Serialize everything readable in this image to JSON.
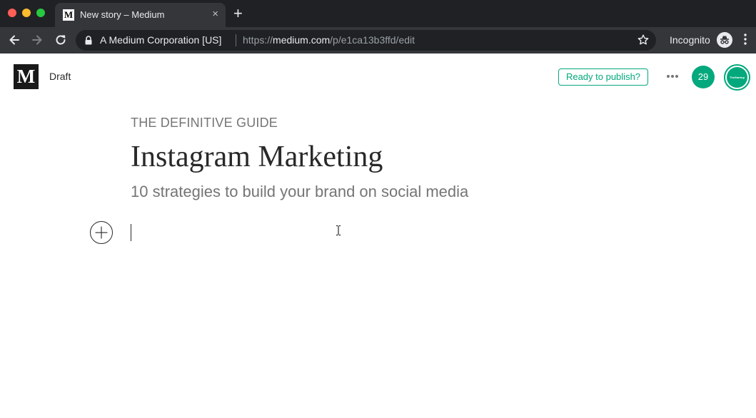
{
  "browser": {
    "tab": {
      "title": "New story – Medium",
      "favicon_letter": "M",
      "close_icon": "×"
    },
    "new_tab_icon": "+",
    "address": {
      "site_identity": "A Medium Corporation [US]",
      "url_scheme": "https://",
      "url_host": "medium.com",
      "url_path": "/p/e1ca13b3ffd/edit"
    },
    "incognito_label": "Incognito"
  },
  "header": {
    "logo_letter": "M",
    "status": "Draft",
    "publish_label": "Ready to publish?",
    "notification_count": "29",
    "avatar_text": "TheStartup"
  },
  "story": {
    "kicker": "THE DEFINITIVE GUIDE",
    "title": "Instagram Marketing",
    "subtitle": "10 strategies to build your brand on social media"
  },
  "colors": {
    "accent": "#03a87c",
    "chrome_dark": "#202124",
    "chrome_toolbar": "#35363a",
    "text_primary": "#292929",
    "text_muted": "#757575"
  },
  "icons": {
    "back": "arrow-left-icon",
    "forward": "arrow-right-icon",
    "reload": "reload-icon",
    "lock": "lock-icon",
    "bookmark": "star-icon",
    "incognito": "incognito-icon",
    "menu": "kebab-menu-icon",
    "more": "more-dots-icon",
    "insert": "plus-circle-icon"
  }
}
